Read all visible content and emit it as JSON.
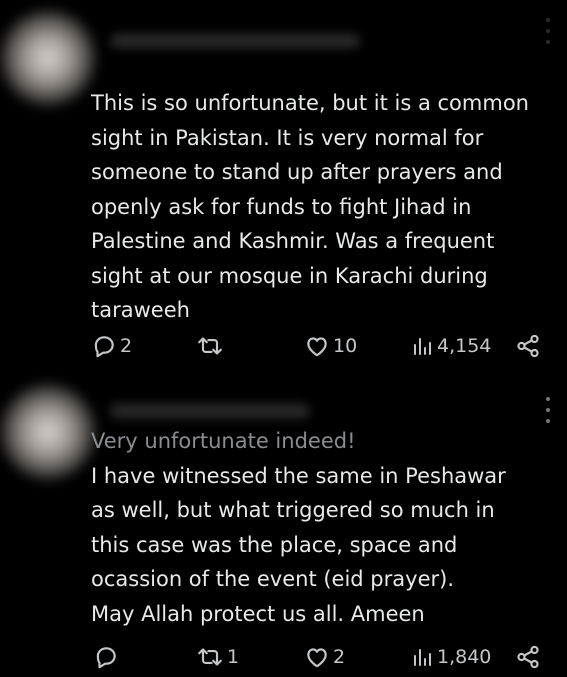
{
  "posts": [
    {
      "text_faded": "",
      "text": "This is so unfortunate, but it is a common\nsight in Pakistan. It is very normal for\nsomeone to stand up after prayers and\nopenly ask for funds to fight Jihad in\nPalestine and Kashmir. Was a frequent\nsight at our mosque in Karachi during\ntaraweeh",
      "actions": {
        "reply_count": "2",
        "repost_count": "",
        "like_count": "10",
        "view_count": "4,154"
      },
      "icons": [
        "reply-icon",
        "repost-icon",
        "like-icon",
        "views-icon",
        "share-icon",
        "more-icon"
      ]
    },
    {
      "text_faded": "Very unfortunate indeed!",
      "text": "I have witnessed the same in Peshawar\nas well, but what triggered so much in\nthis case was the place, space and\nocassion of the event (eid prayer).\nMay Allah protect us all. Ameen",
      "actions": {
        "reply_count": "",
        "repost_count": "1",
        "like_count": "2",
        "view_count": "1,840"
      },
      "icons": [
        "reply-icon",
        "repost-icon",
        "like-icon",
        "views-icon",
        "share-icon",
        "more-icon"
      ]
    }
  ],
  "colors": {
    "background": "#000000",
    "text": "#e7e9ea",
    "icon": "#c4c7ca",
    "muted": "#71767b"
  }
}
